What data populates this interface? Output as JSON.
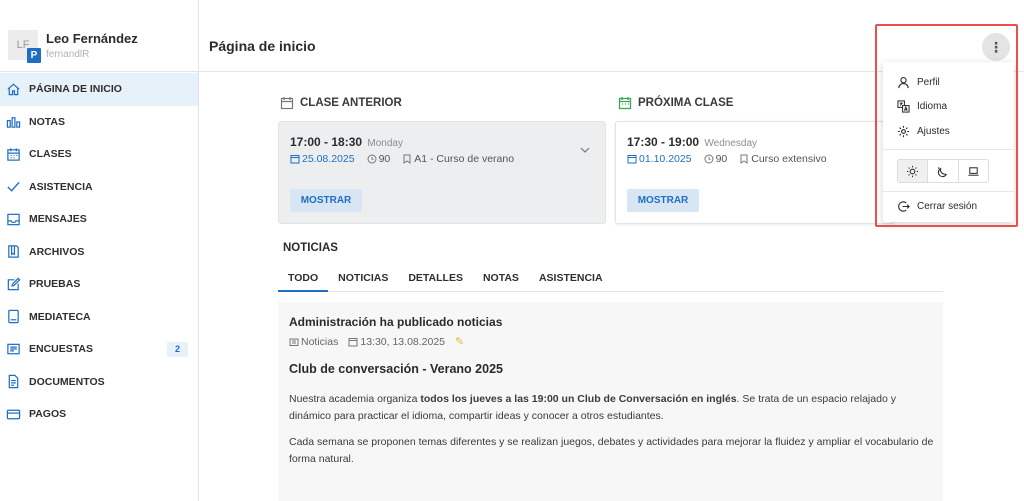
{
  "profile": {
    "initials": "LF",
    "badge": "P",
    "name": "Leo Fernández",
    "username": "fernandlR"
  },
  "nav": {
    "items": [
      {
        "label": "PÁGINA DE INICIO",
        "icon": "home-icon"
      },
      {
        "label": "NOTAS",
        "icon": "chart-icon"
      },
      {
        "label": "CLASES",
        "icon": "calendar-icon"
      },
      {
        "label": "ASISTENCIA",
        "icon": "check-icon"
      },
      {
        "label": "MENSAJES",
        "icon": "inbox-icon"
      },
      {
        "label": "ARCHIVOS",
        "icon": "book-icon"
      },
      {
        "label": "PRUEBAS",
        "icon": "edit-icon"
      },
      {
        "label": "MEDIATECA",
        "icon": "tablet-icon"
      },
      {
        "label": "ENCUESTAS",
        "icon": "survey-icon",
        "badge": "2"
      },
      {
        "label": "DOCUMENTOS",
        "icon": "document-icon"
      },
      {
        "label": "PAGOS",
        "icon": "card-icon"
      }
    ]
  },
  "header": {
    "title": "Página de inicio"
  },
  "prev_class": {
    "title": "CLASE ANTERIOR",
    "time": "17:00 - 18:30",
    "day": "Monday",
    "date": "25.08.2025",
    "duration": "90",
    "course": "A1 - Curso de verano",
    "button": "MOSTRAR"
  },
  "next_class": {
    "title": "PRÓXIMA CLASE",
    "time": "17:30 - 19:00",
    "day": "Wednesday",
    "date": "01.10.2025",
    "duration": "90",
    "course": "Curso extensivo",
    "button": "MOSTRAR"
  },
  "news": {
    "title": "NOTICIAS",
    "tabs": [
      "TODO",
      "NOTICIAS",
      "DETALLES",
      "NOTAS",
      "ASISTENCIA"
    ],
    "card": {
      "heading": "Administración ha publicado noticias",
      "category": "Noticias",
      "timestamp": "13:30, 13.08.2025",
      "subtitle": "Club de conversación - Verano 2025",
      "p1_before": "Nuestra academia organiza ",
      "p1_bold": "todos los jueves a las 19:00 un Club de Conversación en inglés",
      "p1_after": ". Se trata de un espacio relajado y dinámico para practicar el idioma, compartir ideas y conocer a otros estudiantes.",
      "p2": "Cada semana se proponen temas diferentes y se realizan juegos, debates y actividades para mejorar la fluidez y ampliar el vocabulario de forma natural."
    }
  },
  "menu": {
    "profile": "Perfil",
    "language": "Idioma",
    "settings": "Ajustes",
    "logout": "Cerrar sesión"
  },
  "colors": {
    "accent": "#1e6fc4",
    "highlight": "#e94f4f",
    "green_icon": "#3aa757"
  }
}
